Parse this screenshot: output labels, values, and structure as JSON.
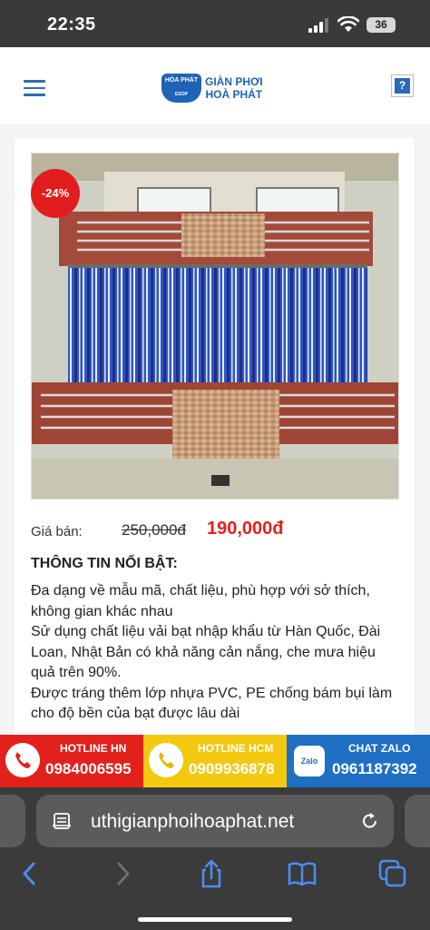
{
  "status_bar": {
    "time": "22:35",
    "battery": "36"
  },
  "header": {
    "logo_badge_top": "HÒA PHÁT",
    "logo_badge_bottom": "ESOP",
    "logo_line1": "GIÀN PHƠI",
    "logo_line2": "HOÀ PHÁT",
    "help_label": "?"
  },
  "product": {
    "discount": "-24%",
    "price_label": "Giá bán:",
    "price_old": "250,000đ",
    "price_new": "190,000đ",
    "highlights_title": "THÔNG TIN NỔI BẬT:",
    "highlights": [
      "Đa dạng về mẫu mã, chất liệu, phù hợp với sở thích, không gian khác nhau",
      "Sử dụng chất liệu vải bạt nhập khẩu từ Hàn Quốc, Đài Loan, Nhật Bản có khả năng cản nắng, che mưa hiệu quả trên 90%.",
      "Được tráng thêm lớp nhựa PVC, PE chống bám bụi làm cho độ bền của bạt được lâu dài"
    ]
  },
  "hotlines": [
    {
      "label": "HOTLINE HN",
      "number": "0984006595",
      "color": "#e3211c"
    },
    {
      "label": "HOTLINE HCM",
      "number": "0909936878",
      "color": "#f3c910"
    },
    {
      "label": "CHAT ZALO",
      "number": "0961187392",
      "color": "#1f6fc5",
      "icon_text": "Zalo"
    }
  ],
  "browser": {
    "url": "uthigianphoihoaphat.net",
    "icons": [
      "reader-icon",
      "reload-icon",
      "back-icon",
      "forward-icon",
      "share-icon",
      "bookmarks-icon",
      "tabs-icon"
    ]
  }
}
